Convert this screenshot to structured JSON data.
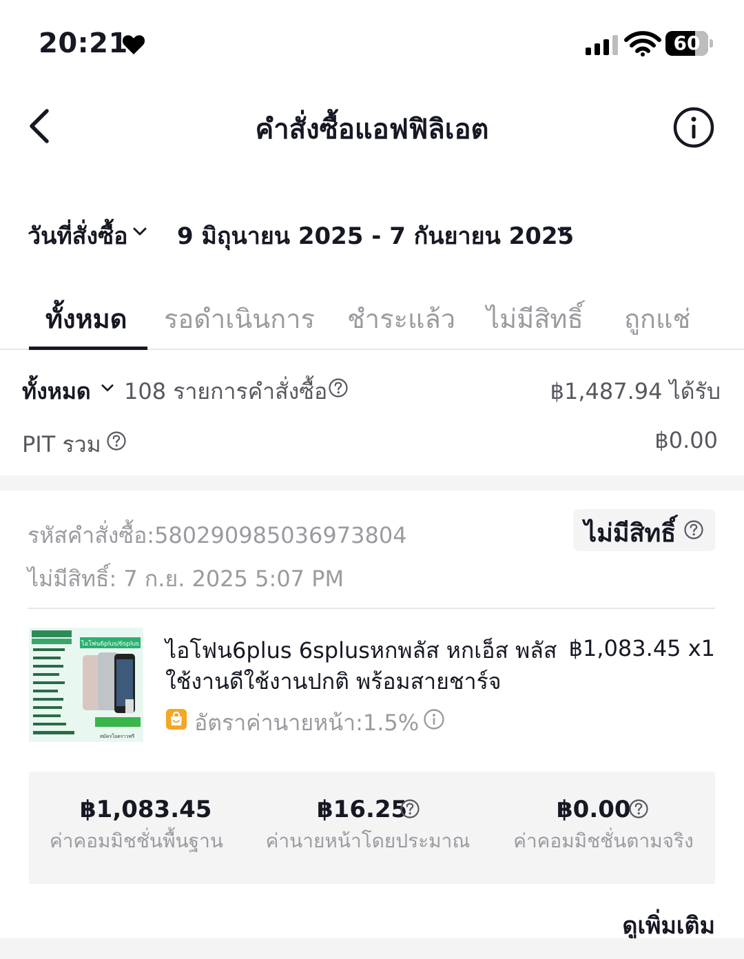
{
  "status_bar": {
    "time": "20:21",
    "battery": "60"
  },
  "header": {
    "title": "คำสั่งซื้อแอฟฟิลิเอต"
  },
  "filters": {
    "date_type": "วันที่สั่งซื้อ",
    "date_range": "9 มิถุนายน 2025 - 7 กันยายน 2025"
  },
  "tabs": [
    {
      "label": "ทั้งหมด",
      "active": true
    },
    {
      "label": "รอดำเนินการ"
    },
    {
      "label": "ชำระแล้ว"
    },
    {
      "label": "ไม่มีสิทธิ์"
    },
    {
      "label": "ถูกแช่"
    }
  ],
  "summary": {
    "filter": "ทั้งหมด",
    "count_text": "108 รายการคำสั่งซื้อ",
    "total": "฿1,487.94 ได้รับ",
    "pit_label": "PIT รวม",
    "pit_value": "฿0.00"
  },
  "order": {
    "id_text": "รหัสคำสั่งซื้อ:580290985036973804",
    "status": "ไม่มีสิทธิ์",
    "ineligible_text": "ไม่มีสิทธิ์: 7 ก.ย. 2025 5:07 PM",
    "product": {
      "name": "ไอโฟน6plus 6splusหกพลัส หกเอ็ส พลัส ใช้งานดีใช้งานปกติ พร้อมสายชาร์จ",
      "price": "฿1,083.45 x1",
      "rate": "อัตราค่านายหน้า:1.5%",
      "image_texts": [
        "ไอโฟน6plus/6splus",
        "สมัครโอดราวฟรี"
      ]
    },
    "commission": [
      {
        "value": "฿1,083.45",
        "label": "ค่าคอมมิชชั่นพื้นฐาน"
      },
      {
        "value": "฿16.25",
        "label": "ค่านายหน้าโดยประมาณ"
      },
      {
        "value": "฿0.00",
        "label": "ค่าคอมมิชชั่นตามจริง"
      }
    ],
    "see_more": "ดูเพิ่มเติม"
  },
  "colors": {
    "text_primary": "#161823",
    "text_secondary": "#9a9aa0",
    "panel_bg": "#f4f4f5",
    "rate_icon": "#f5a623"
  },
  "icons": [
    "heart-icon",
    "signal-icon",
    "wifi-icon",
    "battery-icon",
    "back-icon",
    "info-icon",
    "chevron-down-icon",
    "help-icon",
    "shop-bag-icon"
  ]
}
